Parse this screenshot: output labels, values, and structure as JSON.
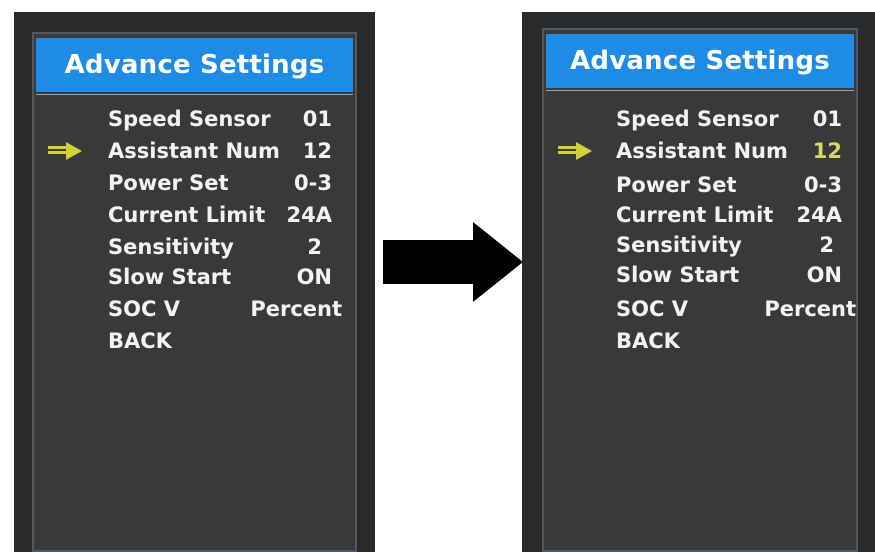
{
  "screens": [
    {
      "title": "Advance Settings",
      "items": [
        {
          "label": "Speed  Sensor",
          "value": "01"
        },
        {
          "label": "Assistant  Num",
          "value": "12"
        },
        {
          "label": "Power  Set",
          "value": "0-3"
        },
        {
          "label": "Current Limit",
          "value": "24A"
        },
        {
          "label": "Sensitivity",
          "value": "2"
        },
        {
          "label": "Slow Start",
          "value": "ON"
        },
        {
          "label": "SOC V",
          "value": "Percent"
        },
        {
          "label": "BACK",
          "value": ""
        }
      ],
      "selected_index": 1
    },
    {
      "title": "Advance Settings",
      "items": [
        {
          "label": "Speed  Sensor",
          "value": "01"
        },
        {
          "label": "Assistant  Num",
          "value": "12"
        },
        {
          "label": "Power  Set",
          "value": "0-3"
        },
        {
          "label": "Current Limit",
          "value": "24A"
        },
        {
          "label": "Sensitivity",
          "value": "2"
        },
        {
          "label": "Slow Start",
          "value": "ON"
        },
        {
          "label": "SOC V",
          "value": "Percent"
        },
        {
          "label": "BACK",
          "value": ""
        }
      ],
      "selected_index": 1,
      "editing_value": true
    }
  ],
  "colors": {
    "header": "#1e8ce6",
    "screen_bg": "#393939",
    "text": "#f2f2f2",
    "cursor_arrow": "#cfd23a",
    "editing_value": "#d8d86a"
  },
  "icons": {
    "selection": "arrow-right-icon",
    "transition": "arrow-right-icon"
  }
}
